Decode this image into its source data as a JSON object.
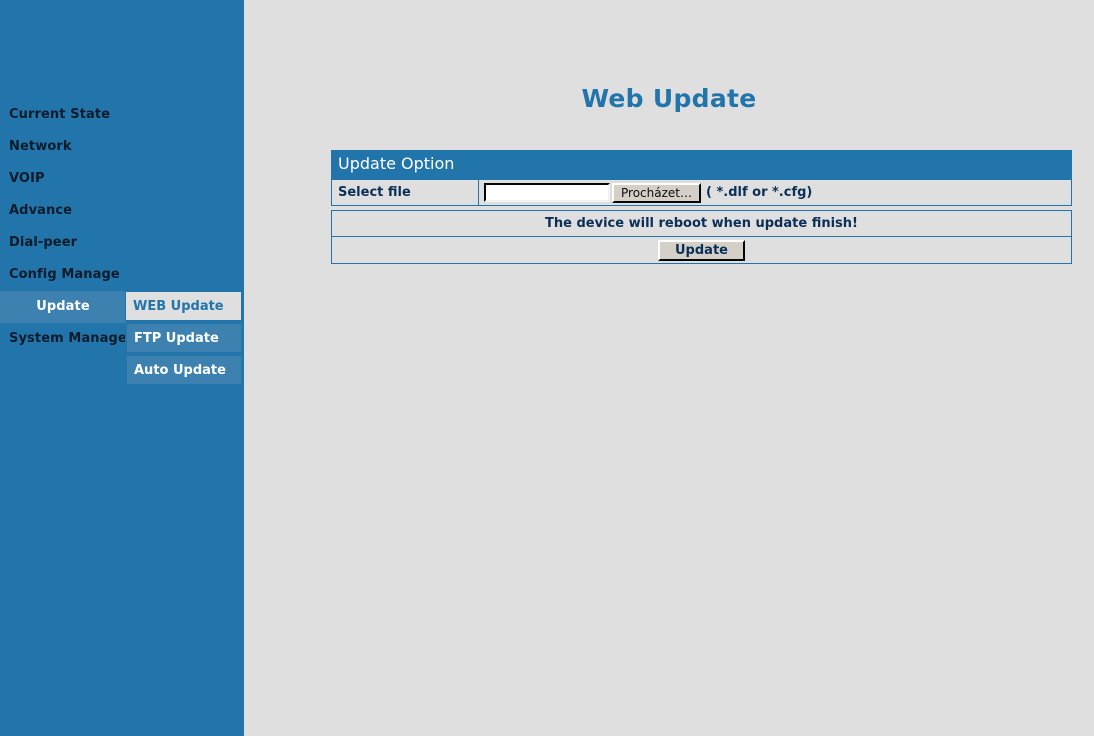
{
  "colors": {
    "brand_blue": "#2275ab",
    "sidebar_selected": "#3d81b0",
    "page_background": "#dfdfdf",
    "text_navy": "#0b2f57",
    "button_face": "#d4d0c8"
  },
  "sidebar": {
    "items": [
      {
        "label": "Current State",
        "selected": false
      },
      {
        "label": "Network",
        "selected": false
      },
      {
        "label": "VOIP",
        "selected": false
      },
      {
        "label": "Advance",
        "selected": false
      },
      {
        "label": "Dial-peer",
        "selected": false
      },
      {
        "label": "Config Manage",
        "selected": false
      },
      {
        "label": "Update",
        "selected": true
      },
      {
        "label": "System Manage",
        "selected": false
      }
    ],
    "submenu": [
      {
        "label": "WEB Update",
        "active": true
      },
      {
        "label": "FTP Update",
        "active": false
      },
      {
        "label": "Auto Update",
        "active": false
      }
    ]
  },
  "main": {
    "title": "Web Update",
    "panel": {
      "header": "Update Option",
      "select_file_label": "Select file",
      "file_value": "",
      "file_placeholder": "",
      "browse_button": "Procházet…",
      "file_hint": "( *.dlf or *.cfg)",
      "notice": "The device will reboot when update finish!",
      "update_button": "Update"
    }
  }
}
